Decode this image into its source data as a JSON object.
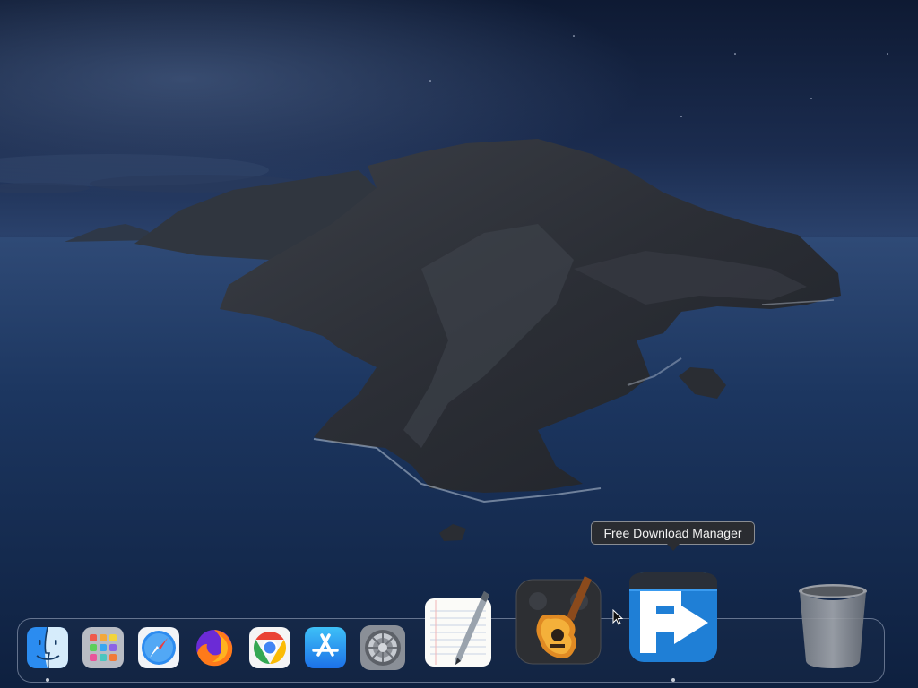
{
  "tooltip": {
    "text": "Free Download Manager"
  },
  "dock": {
    "items": [
      {
        "name": "Finder",
        "icon": "finder-icon",
        "running": true
      },
      {
        "name": "Launchpad",
        "icon": "launchpad-icon",
        "running": false
      },
      {
        "name": "Safari",
        "icon": "safari-icon",
        "running": false
      },
      {
        "name": "Firefox",
        "icon": "firefox-icon",
        "running": false
      },
      {
        "name": "Google Chrome",
        "icon": "chrome-icon",
        "running": false
      },
      {
        "name": "App Store",
        "icon": "app-store-icon",
        "running": false
      },
      {
        "name": "System Preferences",
        "icon": "system-preferences-icon",
        "running": false
      },
      {
        "name": "TextEdit",
        "icon": "textedit-icon",
        "running": false
      },
      {
        "name": "GarageBand",
        "icon": "garageband-icon",
        "running": false
      },
      {
        "name": "Free Download Manager",
        "icon": "free-download-manager-icon",
        "running": true,
        "hovered": true
      },
      {
        "name": "Trash",
        "icon": "trash-icon",
        "running": false
      }
    ]
  },
  "colors": {
    "tooltip_bg": "#2a2c31",
    "sky": "#1b2c4f",
    "sea": "#193257",
    "fdm_blue": "#1f7fd6"
  }
}
